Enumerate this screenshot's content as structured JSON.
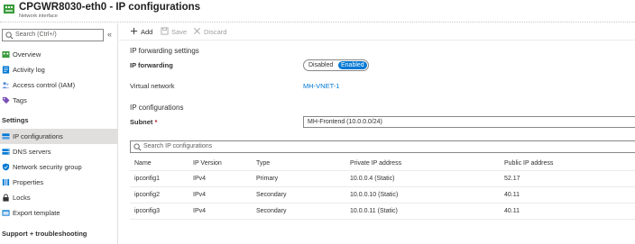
{
  "header": {
    "title": "CPGWR8030-eth0 - IP configurations",
    "subtitle": "Network interface",
    "icon": "network-interface-icon"
  },
  "sidebar": {
    "search_placeholder": "Search (Ctrl+/)",
    "collapse_glyph": "«",
    "items": [
      {
        "label": "Overview",
        "icon": "overview-icon"
      },
      {
        "label": "Activity log",
        "icon": "activity-log-icon"
      },
      {
        "label": "Access control (IAM)",
        "icon": "access-control-icon"
      },
      {
        "label": "Tags",
        "icon": "tag-icon"
      }
    ],
    "settings_header": "Settings",
    "settings_items": [
      {
        "label": "IP configurations",
        "icon": "ip-configurations-icon",
        "active": true
      },
      {
        "label": "DNS servers",
        "icon": "dns-servers-icon"
      },
      {
        "label": "Network security group",
        "icon": "network-security-group-icon"
      },
      {
        "label": "Properties",
        "icon": "properties-icon"
      },
      {
        "label": "Locks",
        "icon": "lock-icon"
      },
      {
        "label": "Export template",
        "icon": "export-template-icon"
      }
    ],
    "support_header": "Support + troubleshooting"
  },
  "toolbar": {
    "add_label": "Add",
    "save_label": "Save",
    "discard_label": "Discard"
  },
  "forwarding": {
    "section_title": "IP forwarding settings",
    "label": "IP forwarding",
    "options": [
      "Disabled",
      "Enabled"
    ],
    "selected": "Enabled"
  },
  "vnet": {
    "label": "Virtual network",
    "value": "MH-VNET-1"
  },
  "ipconfig": {
    "section_title": "IP configurations",
    "subnet_label": "Subnet",
    "required_marker": "*",
    "subnet_value": "MH-Frontend (10.0.0.0/24)",
    "search_placeholder": "Search IP configurations"
  },
  "table": {
    "columns": [
      "Name",
      "IP Version",
      "Type",
      "Private IP address",
      "Public IP address"
    ],
    "rows": [
      [
        "ipconfig1",
        "IPv4",
        "Primary",
        "10.0.0.4 (Static)",
        "52.17"
      ],
      [
        "ipconfig2",
        "IPv4",
        "Secondary",
        "10.0.0.10 (Static)",
        "40.11"
      ],
      [
        "ipconfig3",
        "IPv4",
        "Secondary",
        "10.0.0.11 (Static)",
        "40.11"
      ]
    ]
  },
  "colors": {
    "accent": "#0078d4",
    "active_nav_bg": "#e1dfdd",
    "disabled_text": "#a19f9d",
    "required": "#a4262c"
  }
}
